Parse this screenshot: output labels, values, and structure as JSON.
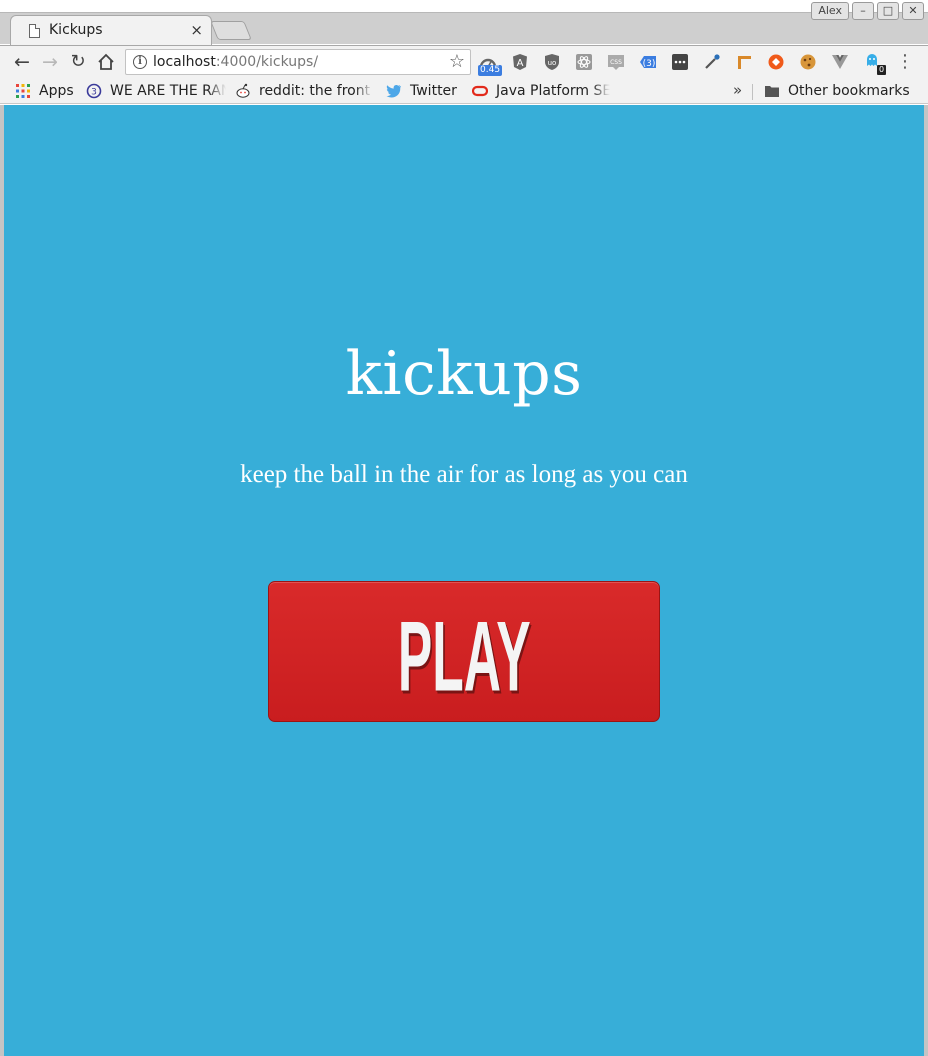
{
  "window": {
    "user_label": "Alex",
    "minimize_glyph": "–",
    "maximize_glyph": "□",
    "close_glyph": "✕"
  },
  "tab": {
    "title": "Kickups",
    "close_glyph": "×"
  },
  "toolbar": {
    "url_host": "localhost",
    "url_path": ":4000/kickups/",
    "extension_badge": "0.45",
    "ghostery_badge": "0",
    "extensions": [
      "speed-gauge-icon",
      "angular-icon",
      "ublock-icon",
      "react-icon",
      "css-icon",
      "redux-icon",
      "dots-ext-icon",
      "eyedropper-icon",
      "ruler-icon",
      "orange-ext-icon",
      "cookie-icon",
      "vue-icon",
      "ghostery-icon"
    ]
  },
  "bookmarks": {
    "items": [
      {
        "label": "Apps",
        "icon": "apps-grid-icon"
      },
      {
        "label": "WE ARE THE RAN",
        "icon": "globe-icon"
      },
      {
        "label": "reddit: the front",
        "icon": "reddit-icon"
      },
      {
        "label": "Twitter",
        "icon": "twitter-bird-icon"
      },
      {
        "label": "Java Platform SE",
        "icon": "oracle-icon"
      }
    ],
    "more_glyph": "»",
    "other_label": "Other bookmarks"
  },
  "page": {
    "title": "kickups",
    "tagline": "keep the ball in the air for as long as you can",
    "play_label": "PLAY",
    "background": "#37aed8",
    "button_color": "#d02326"
  }
}
